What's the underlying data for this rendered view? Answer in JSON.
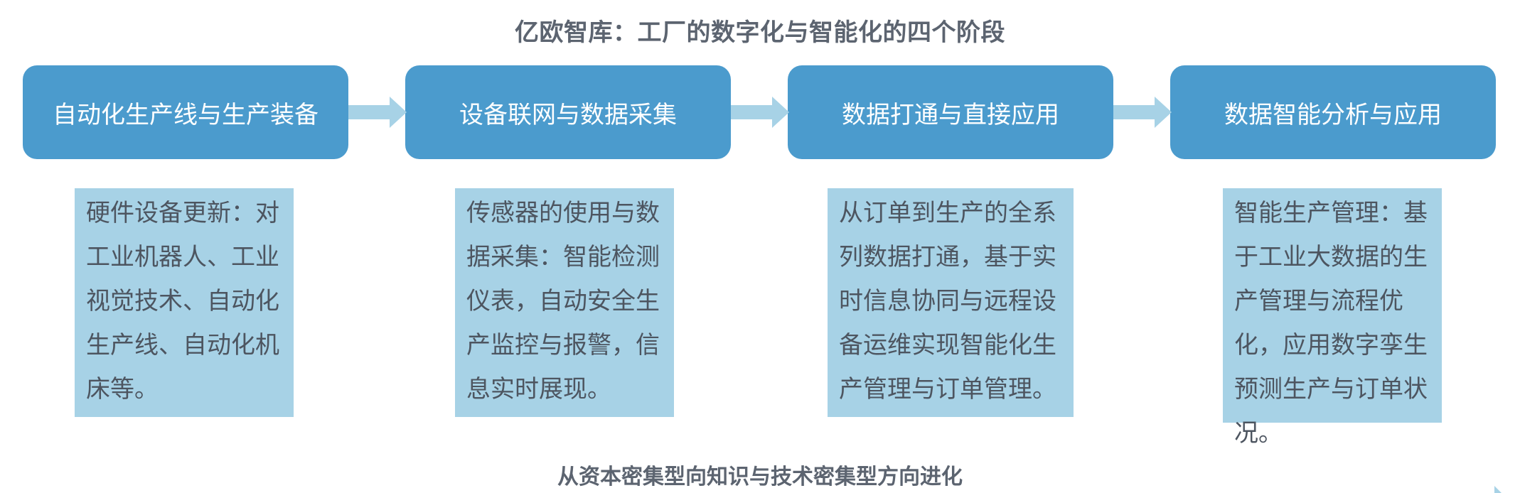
{
  "title": "亿欧智库：工厂的数字化与智能化的四个阶段",
  "stages": [
    {
      "label": "自动化生产线与生产装备",
      "description": "硬件设备更新：对工业机器人、工业视觉技术、自动化生产线、自动化机床等。"
    },
    {
      "label": "设备联网与数据采集",
      "description": "传感器的使用与数据采集：智能检测仪表，自动安全生产监控与报警，信息实时展现。"
    },
    {
      "label": "数据打通与直接应用",
      "description": "从订单到生产的全系列数据打通，基于实时信息协同与远程设备运维实现智能化生产管理与订单管理。"
    },
    {
      "label": "数据智能分析与应用",
      "description": "智能生产管理：基于工业大数据的生产管理与流程优化，应用数字孪生预测生产与订单状况。"
    }
  ],
  "footer": "从资本密集型向知识与技术密集型方向进化",
  "colors": {
    "stage_fill": "#4b9bcd",
    "description_fill": "#a7d2e6",
    "arrow_fill": "#a7d2e6",
    "title_text": "#5c6470"
  }
}
